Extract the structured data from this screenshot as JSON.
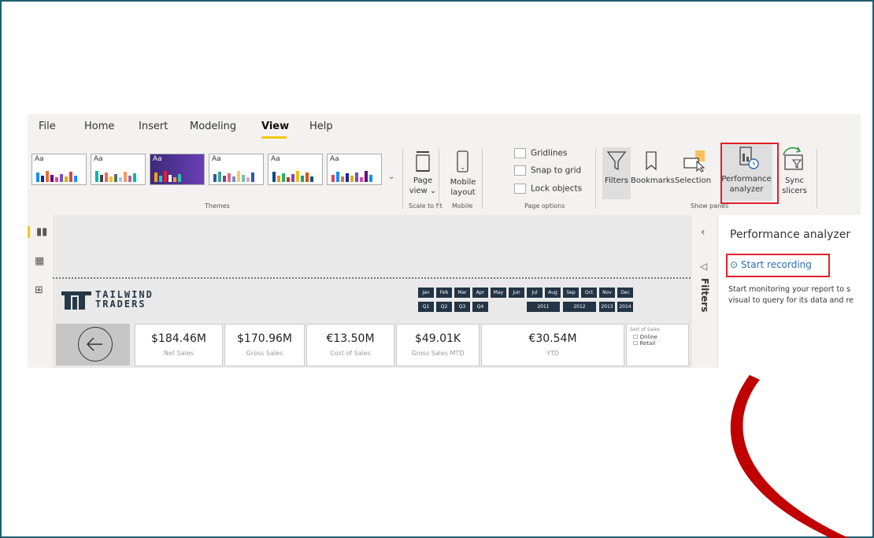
{
  "ribbon": {
    "tabs": [
      {
        "label": "File"
      },
      {
        "label": "Home"
      },
      {
        "label": "Insert"
      },
      {
        "label": "Modeling"
      },
      {
        "label": "View",
        "active": true
      },
      {
        "label": "Help"
      }
    ],
    "groups": {
      "themes": "Themes",
      "scale_to_fit": "Scale to fit",
      "mobile": "Mobile",
      "page_options": "Page options",
      "show_panes": "Show panes"
    },
    "theme_preview_text": "Aa",
    "page_view": [
      "Page",
      "view ⌄"
    ],
    "mobile_layout": [
      "Mobile",
      "layout"
    ],
    "checkboxes": [
      "Gridlines",
      "Snap to grid",
      "Lock objects"
    ],
    "panes": {
      "filters": "Filters",
      "bookmarks": "Bookmarks",
      "selection": "Selection",
      "performance": [
        "Performance",
        "analyzer"
      ],
      "sync": [
        "Sync",
        "slicers"
      ]
    }
  },
  "report": {
    "logo": [
      "TAILWIND",
      "TRADERS"
    ],
    "months": [
      "Jan",
      "Feb",
      "Mar",
      "Apr",
      "May",
      "Jun",
      "Jul",
      "Aug",
      "Sep",
      "Oct",
      "Nov",
      "Dec"
    ],
    "quarters": [
      "Q1",
      "Q2",
      "Q3",
      "Q4"
    ],
    "years": [
      "2011",
      "2012",
      "2013",
      "2014"
    ],
    "cards": [
      {
        "value": "$184.46M",
        "label": "Net Sales"
      },
      {
        "value": "$170.96M",
        "label": "Gross Sales"
      },
      {
        "value": "€13.50M",
        "label": "Cost of Sales"
      },
      {
        "value": "$49.01K",
        "label": "Gross Sales MTD"
      },
      {
        "value": "€30.54M",
        "label": "YTD"
      }
    ],
    "sort": {
      "title": "Sort of Sales",
      "options": [
        "Online",
        "Retail"
      ]
    }
  },
  "filters_pane": {
    "label": "Filters"
  },
  "perf_pane": {
    "title": "Performance analyzer",
    "start_recording": "Start recording",
    "description": [
      "Start monitoring your report to s",
      "visual to query for its data and re"
    ]
  },
  "colors": {
    "highlight_box": "#e0202a",
    "arc": "#c00000",
    "accent_underline": "#f2c811",
    "navy": "#233445"
  }
}
